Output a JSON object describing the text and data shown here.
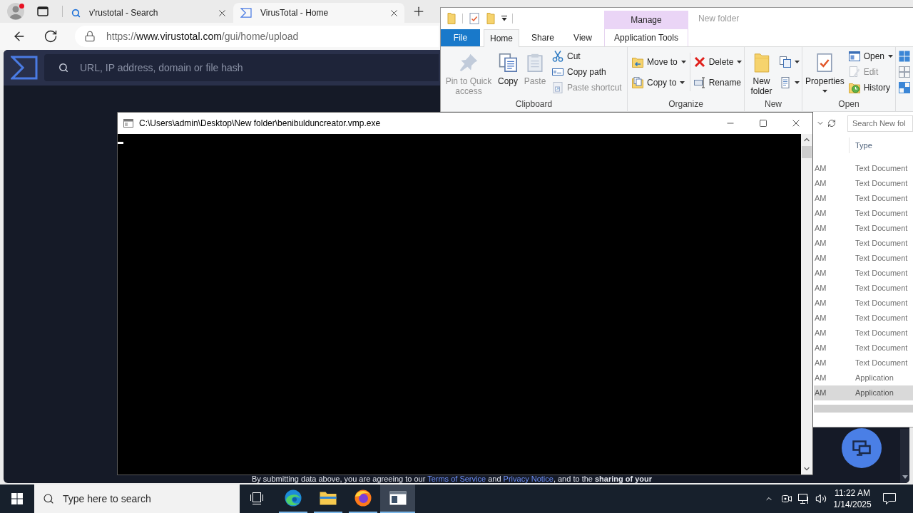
{
  "browser": {
    "profile": {
      "alert": true
    },
    "tabs": [
      {
        "title": "v'rustotal - Search",
        "kind": "search",
        "selected": false
      },
      {
        "title": "VirusTotal - Home",
        "kind": "site",
        "selected": true
      }
    ],
    "address": {
      "scheme": "https://",
      "host": "www.virustotal.com",
      "path": "/gui/home/upload"
    },
    "page": {
      "search_placeholder": "URL, IP address, domain or file hash",
      "notice": {
        "text_1": "By submitting data above, you are agreeing to our",
        "link_1": "Terms of Service",
        "text_2": "and",
        "link_2": "Privacy Notice",
        "text_3": ", and to the **sharing of your**"
      }
    }
  },
  "explorer": {
    "context_tab": "Manage",
    "title": "New folder",
    "tabs": [
      {
        "label": "File",
        "kind": "menu",
        "selected": false
      },
      {
        "label": "Home",
        "kind": "tab",
        "selected": true
      },
      {
        "label": "Share",
        "kind": "tab",
        "selected": false
      },
      {
        "label": "View",
        "kind": "tab",
        "selected": false
      },
      {
        "label": "Application Tools",
        "kind": "context",
        "selected": false
      }
    ],
    "groups": [
      {
        "label": "Clipboard",
        "items": [
          {
            "kind": "large",
            "label": "Pin to Quick access",
            "disabled": true,
            "dropdown": false
          },
          {
            "kind": "large",
            "label": "Copy",
            "disabled": false,
            "dropdown": false
          },
          {
            "kind": "large",
            "label": "Paste",
            "disabled": true,
            "dropdown": false
          },
          {
            "kind": "stack",
            "commands": [
              {
                "label": "Cut",
                "disabled": false,
                "dropdown": false
              },
              {
                "label": "Copy path",
                "disabled": false,
                "dropdown": false
              },
              {
                "label": "Paste shortcut",
                "disabled": true,
                "dropdown": false
              }
            ]
          }
        ]
      },
      {
        "label": "Organize",
        "items": [
          {
            "kind": "stack",
            "commands": [
              {
                "label": "Move to",
                "disabled": false,
                "dropdown": true
              },
              {
                "label": "Copy to",
                "disabled": false,
                "dropdown": true
              }
            ]
          },
          {
            "kind": "stack",
            "commands": [
              {
                "label": "Delete",
                "disabled": false,
                "dropdown": true
              },
              {
                "label": "Rename",
                "disabled": false,
                "dropdown": false
              }
            ]
          }
        ]
      },
      {
        "label": "New",
        "items": [
          {
            "kind": "large",
            "label": "New folder",
            "disabled": false,
            "dropdown": false
          },
          {
            "kind": "stack",
            "commands": [
              {
                "disabled": false,
                "dropdown": true
              },
              {
                "disabled": false,
                "dropdown": true
              }
            ]
          }
        ]
      },
      {
        "label": "Open",
        "items": [
          {
            "kind": "large",
            "label": "Properties",
            "disabled": false,
            "dropdown": true
          },
          {
            "kind": "stack",
            "commands": [
              {
                "label": "Open",
                "disabled": false,
                "dropdown": true
              },
              {
                "label": "Edit",
                "disabled": true,
                "dropdown": false
              },
              {
                "label": "History",
                "disabled": false,
                "dropdown": false
              }
            ]
          }
        ]
      }
    ],
    "search_placeholder": "Search New fol",
    "columns": [
      {
        "label": "Type"
      }
    ],
    "rows": [
      {
        "date": "AM",
        "type": "Text Document",
        "selected": false
      },
      {
        "date": "AM",
        "type": "Text Document",
        "selected": false
      },
      {
        "date": "AM",
        "type": "Text Document",
        "selected": false
      },
      {
        "date": "AM",
        "type": "Text Document",
        "selected": false
      },
      {
        "date": "AM",
        "type": "Text Document",
        "selected": false
      },
      {
        "date": "AM",
        "type": "Text Document",
        "selected": false
      },
      {
        "date": "AM",
        "type": "Text Document",
        "selected": false
      },
      {
        "date": "AM",
        "type": "Text Document",
        "selected": false
      },
      {
        "date": "AM",
        "type": "Text Document",
        "selected": false
      },
      {
        "date": "AM",
        "type": "Text Document",
        "selected": false
      },
      {
        "date": "AM",
        "type": "Text Document",
        "selected": false
      },
      {
        "date": "AM",
        "type": "Text Document",
        "selected": false
      },
      {
        "date": "AM",
        "type": "Text Document",
        "selected": false
      },
      {
        "date": "AM",
        "type": "Text Document",
        "selected": false
      },
      {
        "date": "AM",
        "type": "Application",
        "selected": false
      },
      {
        "date": "AM",
        "type": "Application",
        "selected": true
      }
    ]
  },
  "console": {
    "title": "C:\\Users\\admin\\Desktop\\New folder\\benibulduncreator.vmp.exe"
  },
  "taskbar": {
    "search_placeholder": "Type here to search",
    "apps": [
      {
        "kind": "task_view",
        "running": false,
        "selected": false
      },
      {
        "kind": "edge",
        "running": true,
        "selected": false
      },
      {
        "kind": "explorer",
        "running": true,
        "selected": false
      },
      {
        "kind": "firefox",
        "running": true,
        "selected": false
      },
      {
        "kind": "console",
        "running": true,
        "selected": true
      }
    ],
    "clock": {
      "time": "11:22 AM",
      "date": "1/14/2025"
    }
  }
}
